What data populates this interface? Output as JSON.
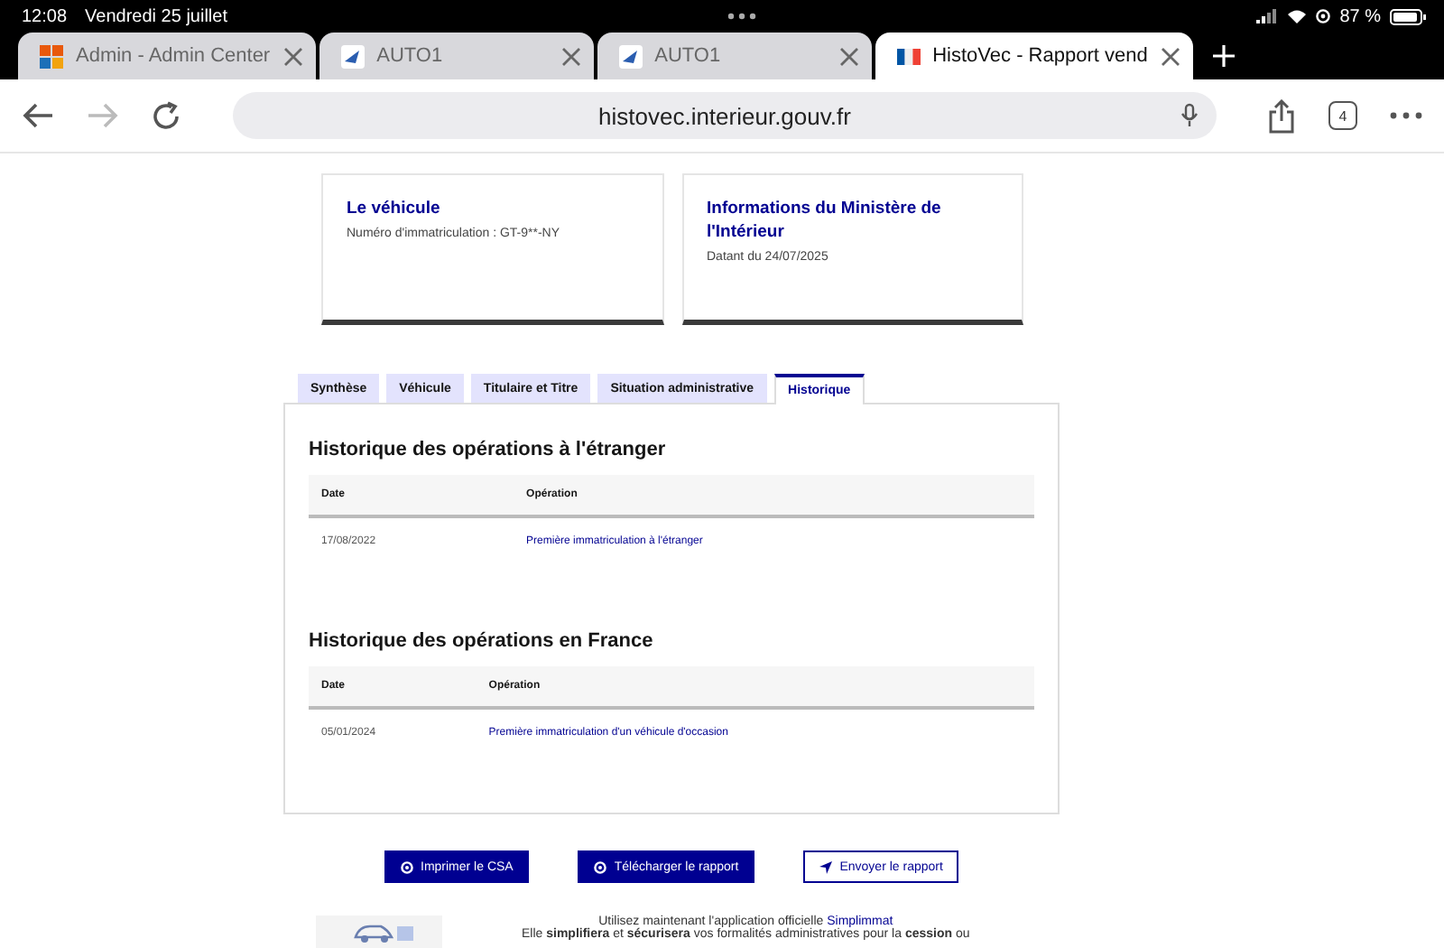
{
  "status_bar": {
    "time": "12:08",
    "date": "Vendredi 25 juillet",
    "battery": "87 %"
  },
  "browser_tabs": [
    {
      "title": "Admin - Admin Center",
      "kind": "grid",
      "selected": false
    },
    {
      "title": "AUTO1",
      "kind": "arrow",
      "selected": false
    },
    {
      "title": "AUTO1",
      "kind": "arrow",
      "selected": false
    },
    {
      "title": "HistoVec - Rapport vend",
      "kind": "flag",
      "selected": true
    }
  ],
  "address_bar": {
    "url": "histovec.interieur.gouv.fr",
    "tab_count": "4"
  },
  "cards": [
    {
      "title": "Le véhicule",
      "text": "Numéro d'immatriculation : GT-9**-NY"
    },
    {
      "title": "Informations du Ministère de l'Intérieur",
      "text": "Datant du 24/07/2025"
    }
  ],
  "tabs": [
    {
      "label": "Synthèse",
      "selected": false
    },
    {
      "label": "Véhicule",
      "selected": false
    },
    {
      "label": "Titulaire et Titre",
      "selected": false
    },
    {
      "label": "Situation administrative",
      "selected": false
    },
    {
      "label": "Historique",
      "selected": true
    }
  ],
  "sections": [
    {
      "title": "Historique des opérations à l'étranger",
      "columns": [
        "Date",
        "Opération"
      ],
      "rows": [
        [
          "17/08/2022",
          "Première immatriculation à l'étranger"
        ]
      ]
    },
    {
      "title": "Historique des opérations en France",
      "columns": [
        "Date",
        "Opération"
      ],
      "rows": [
        [
          "05/01/2024",
          "Première immatriculation d'un véhicule d'occasion"
        ]
      ]
    }
  ],
  "buttons": [
    {
      "label": "Imprimer le CSA",
      "kind": "primary"
    },
    {
      "label": "Télécharger le rapport",
      "kind": "primary"
    },
    {
      "label": "Envoyer le rapport",
      "kind": "secondary"
    }
  ],
  "promo": {
    "text": "Utilisez maintenant l'application officielle",
    "link": "Simplimmat",
    "line_2": "Elle **simplifiera** et **sécurisera** vos formalités administratives pour la **cession** ou"
  }
}
